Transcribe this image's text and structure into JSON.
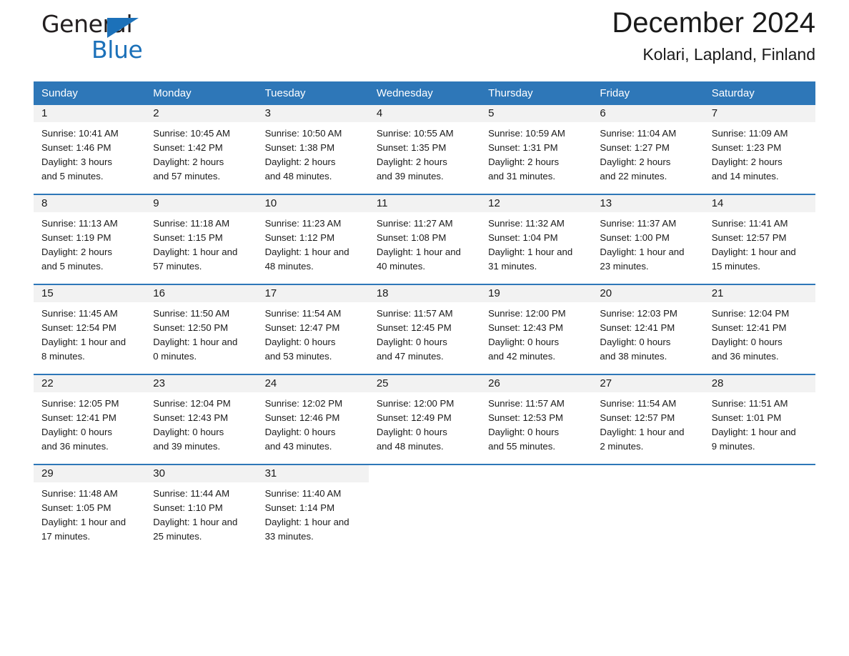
{
  "brand": {
    "word_one": "General",
    "word_two": "Blue",
    "triangle_color": "#1c71b9",
    "text_color": "#231f20"
  },
  "header": {
    "title": "December 2024",
    "subtitle": "Kolari, Lapland, Finland",
    "accent_color": "#2e77b8",
    "day_band_color": "#f2f2f2"
  },
  "weekday_headers": [
    "Sunday",
    "Monday",
    "Tuesday",
    "Wednesday",
    "Thursday",
    "Friday",
    "Saturday"
  ],
  "weeks": [
    [
      {
        "day": "1",
        "sunrise": "Sunrise: 10:41 AM",
        "sunset": "Sunset: 1:46 PM",
        "daylight_1": "Daylight: 3 hours",
        "daylight_2": "and 5 minutes."
      },
      {
        "day": "2",
        "sunrise": "Sunrise: 10:45 AM",
        "sunset": "Sunset: 1:42 PM",
        "daylight_1": "Daylight: 2 hours",
        "daylight_2": "and 57 minutes."
      },
      {
        "day": "3",
        "sunrise": "Sunrise: 10:50 AM",
        "sunset": "Sunset: 1:38 PM",
        "daylight_1": "Daylight: 2 hours",
        "daylight_2": "and 48 minutes."
      },
      {
        "day": "4",
        "sunrise": "Sunrise: 10:55 AM",
        "sunset": "Sunset: 1:35 PM",
        "daylight_1": "Daylight: 2 hours",
        "daylight_2": "and 39 minutes."
      },
      {
        "day": "5",
        "sunrise": "Sunrise: 10:59 AM",
        "sunset": "Sunset: 1:31 PM",
        "daylight_1": "Daylight: 2 hours",
        "daylight_2": "and 31 minutes."
      },
      {
        "day": "6",
        "sunrise": "Sunrise: 11:04 AM",
        "sunset": "Sunset: 1:27 PM",
        "daylight_1": "Daylight: 2 hours",
        "daylight_2": "and 22 minutes."
      },
      {
        "day": "7",
        "sunrise": "Sunrise: 11:09 AM",
        "sunset": "Sunset: 1:23 PM",
        "daylight_1": "Daylight: 2 hours",
        "daylight_2": "and 14 minutes."
      }
    ],
    [
      {
        "day": "8",
        "sunrise": "Sunrise: 11:13 AM",
        "sunset": "Sunset: 1:19 PM",
        "daylight_1": "Daylight: 2 hours",
        "daylight_2": "and 5 minutes."
      },
      {
        "day": "9",
        "sunrise": "Sunrise: 11:18 AM",
        "sunset": "Sunset: 1:15 PM",
        "daylight_1": "Daylight: 1 hour and",
        "daylight_2": "57 minutes."
      },
      {
        "day": "10",
        "sunrise": "Sunrise: 11:23 AM",
        "sunset": "Sunset: 1:12 PM",
        "daylight_1": "Daylight: 1 hour and",
        "daylight_2": "48 minutes."
      },
      {
        "day": "11",
        "sunrise": "Sunrise: 11:27 AM",
        "sunset": "Sunset: 1:08 PM",
        "daylight_1": "Daylight: 1 hour and",
        "daylight_2": "40 minutes."
      },
      {
        "day": "12",
        "sunrise": "Sunrise: 11:32 AM",
        "sunset": "Sunset: 1:04 PM",
        "daylight_1": "Daylight: 1 hour and",
        "daylight_2": "31 minutes."
      },
      {
        "day": "13",
        "sunrise": "Sunrise: 11:37 AM",
        "sunset": "Sunset: 1:00 PM",
        "daylight_1": "Daylight: 1 hour and",
        "daylight_2": "23 minutes."
      },
      {
        "day": "14",
        "sunrise": "Sunrise: 11:41 AM",
        "sunset": "Sunset: 12:57 PM",
        "daylight_1": "Daylight: 1 hour and",
        "daylight_2": "15 minutes."
      }
    ],
    [
      {
        "day": "15",
        "sunrise": "Sunrise: 11:45 AM",
        "sunset": "Sunset: 12:54 PM",
        "daylight_1": "Daylight: 1 hour and",
        "daylight_2": "8 minutes."
      },
      {
        "day": "16",
        "sunrise": "Sunrise: 11:50 AM",
        "sunset": "Sunset: 12:50 PM",
        "daylight_1": "Daylight: 1 hour and",
        "daylight_2": "0 minutes."
      },
      {
        "day": "17",
        "sunrise": "Sunrise: 11:54 AM",
        "sunset": "Sunset: 12:47 PM",
        "daylight_1": "Daylight: 0 hours",
        "daylight_2": "and 53 minutes."
      },
      {
        "day": "18",
        "sunrise": "Sunrise: 11:57 AM",
        "sunset": "Sunset: 12:45 PM",
        "daylight_1": "Daylight: 0 hours",
        "daylight_2": "and 47 minutes."
      },
      {
        "day": "19",
        "sunrise": "Sunrise: 12:00 PM",
        "sunset": "Sunset: 12:43 PM",
        "daylight_1": "Daylight: 0 hours",
        "daylight_2": "and 42 minutes."
      },
      {
        "day": "20",
        "sunrise": "Sunrise: 12:03 PM",
        "sunset": "Sunset: 12:41 PM",
        "daylight_1": "Daylight: 0 hours",
        "daylight_2": "and 38 minutes."
      },
      {
        "day": "21",
        "sunrise": "Sunrise: 12:04 PM",
        "sunset": "Sunset: 12:41 PM",
        "daylight_1": "Daylight: 0 hours",
        "daylight_2": "and 36 minutes."
      }
    ],
    [
      {
        "day": "22",
        "sunrise": "Sunrise: 12:05 PM",
        "sunset": "Sunset: 12:41 PM",
        "daylight_1": "Daylight: 0 hours",
        "daylight_2": "and 36 minutes."
      },
      {
        "day": "23",
        "sunrise": "Sunrise: 12:04 PM",
        "sunset": "Sunset: 12:43 PM",
        "daylight_1": "Daylight: 0 hours",
        "daylight_2": "and 39 minutes."
      },
      {
        "day": "24",
        "sunrise": "Sunrise: 12:02 PM",
        "sunset": "Sunset: 12:46 PM",
        "daylight_1": "Daylight: 0 hours",
        "daylight_2": "and 43 minutes."
      },
      {
        "day": "25",
        "sunrise": "Sunrise: 12:00 PM",
        "sunset": "Sunset: 12:49 PM",
        "daylight_1": "Daylight: 0 hours",
        "daylight_2": "and 48 minutes."
      },
      {
        "day": "26",
        "sunrise": "Sunrise: 11:57 AM",
        "sunset": "Sunset: 12:53 PM",
        "daylight_1": "Daylight: 0 hours",
        "daylight_2": "and 55 minutes."
      },
      {
        "day": "27",
        "sunrise": "Sunrise: 11:54 AM",
        "sunset": "Sunset: 12:57 PM",
        "daylight_1": "Daylight: 1 hour and",
        "daylight_2": "2 minutes."
      },
      {
        "day": "28",
        "sunrise": "Sunrise: 11:51 AM",
        "sunset": "Sunset: 1:01 PM",
        "daylight_1": "Daylight: 1 hour and",
        "daylight_2": "9 minutes."
      }
    ],
    [
      {
        "day": "29",
        "sunrise": "Sunrise: 11:48 AM",
        "sunset": "Sunset: 1:05 PM",
        "daylight_1": "Daylight: 1 hour and",
        "daylight_2": "17 minutes."
      },
      {
        "day": "30",
        "sunrise": "Sunrise: 11:44 AM",
        "sunset": "Sunset: 1:10 PM",
        "daylight_1": "Daylight: 1 hour and",
        "daylight_2": "25 minutes."
      },
      {
        "day": "31",
        "sunrise": "Sunrise: 11:40 AM",
        "sunset": "Sunset: 1:14 PM",
        "daylight_1": "Daylight: 1 hour and",
        "daylight_2": "33 minutes."
      },
      {
        "day": "",
        "sunrise": "",
        "sunset": "",
        "daylight_1": "",
        "daylight_2": ""
      },
      {
        "day": "",
        "sunrise": "",
        "sunset": "",
        "daylight_1": "",
        "daylight_2": ""
      },
      {
        "day": "",
        "sunrise": "",
        "sunset": "",
        "daylight_1": "",
        "daylight_2": ""
      },
      {
        "day": "",
        "sunrise": "",
        "sunset": "",
        "daylight_1": "",
        "daylight_2": ""
      }
    ]
  ]
}
